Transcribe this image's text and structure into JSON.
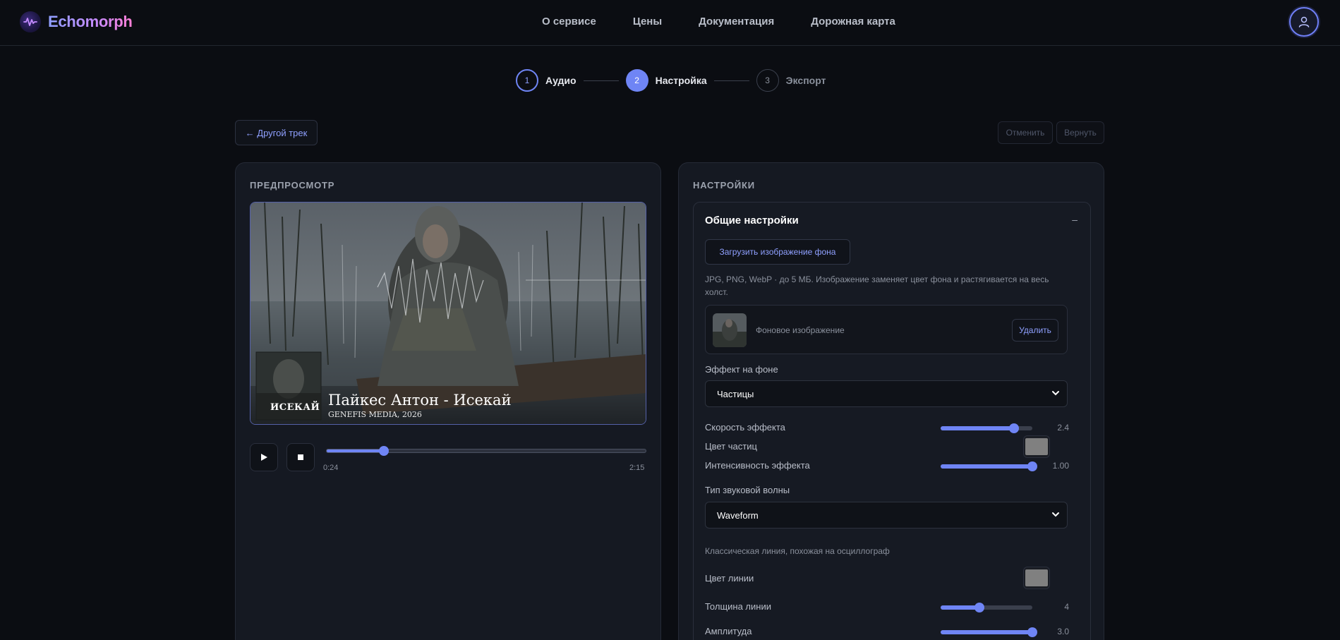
{
  "app": {
    "name": "Echomorph",
    "accent": "#6f85f5"
  },
  "nav": {
    "items": [
      {
        "label": "О сервисе"
      },
      {
        "label": "Цены"
      },
      {
        "label": "Документация"
      },
      {
        "label": "Дорожная карта"
      }
    ]
  },
  "stepper": {
    "steps": [
      {
        "num": "1",
        "label": "Аудио",
        "state": "done"
      },
      {
        "num": "2",
        "label": "Настройка",
        "state": "active"
      },
      {
        "num": "3",
        "label": "Экспорт",
        "state": "pending"
      }
    ]
  },
  "toolbar": {
    "back_label": "← Другой трек",
    "undo_label": "Отменить",
    "redo_label": "Вернуть"
  },
  "preview": {
    "section_title": "ПРЕДПРОСМОТР",
    "track_title": "Пайкес Антон - Исекай",
    "track_subtitle": "GENEFIS MEDIA, 2026",
    "cover_text": "ИСЕКАЙ"
  },
  "player": {
    "current_time": "0:24",
    "total_time": "2:15",
    "progress": 0.18
  },
  "settings": {
    "section_title": "НАСТРОЙКИ",
    "group_title": "Общие настройки",
    "group_toggle": "–",
    "upload_label": "Загрузить изображение фона",
    "upload_hint": "JPG, PNG, WebP · до 5 МБ. Изображение заменяет цвет фона и растягивается на весь холст.",
    "bg_card_name": "Фоновое изображение",
    "bg_delete_label": "Удалить",
    "effect_label": "Эффект на фоне",
    "effect_value": "Частицы",
    "speed_label": "Скорость эффекта",
    "speed_value": "2.4",
    "speed_fraction": 0.8,
    "particle_color_label": "Цвет частиц",
    "particle_color": "#808080",
    "intensity_label": "Интенсивность эффекта",
    "intensity_value": "1.00",
    "intensity_fraction": 1.0,
    "wave_type_label": "Тип звуковой волны",
    "wave_type_value": "Waveform",
    "wave_hint": "Классическая линия, похожая на осциллограф",
    "line_color_label": "Цвет линии",
    "line_color": "#808080",
    "line_width_label": "Толщина линии",
    "line_width_value": "4",
    "line_width_fraction": 0.42,
    "amplitude_label": "Амплитуда",
    "amplitude_value": "3.0",
    "amplitude_fraction": 1.0
  }
}
